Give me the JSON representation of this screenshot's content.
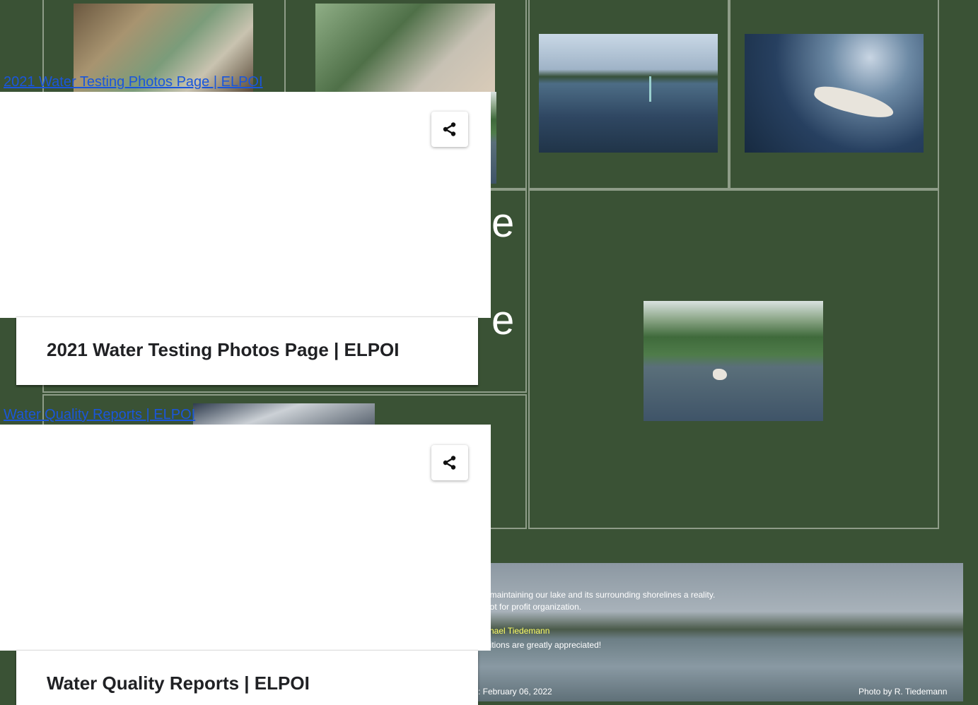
{
  "cards": [
    {
      "link_text": "2021 Water Testing Photos Page | ELPOI",
      "title": "2021 Water Testing Photos Page | ELPOI"
    },
    {
      "link_text": "Water Quality Reports | ELPOI",
      "title": "Water Quality Reports | ELPOI"
    }
  ],
  "background_page": {
    "partial_heading_char_1": "e",
    "partial_heading_char_2": "e",
    "banner": {
      "line1": "f maintaining our lake and its surrounding shorelines a reality.",
      "line2": "not for profit organization.",
      "line3": "chael Tiedemann",
      "line4": "ditions are greatly appreciated!",
      "date": ": February 06, 2022",
      "credit": "Photo by R. Tiedemann"
    }
  },
  "icons": {
    "share": "share-icon"
  },
  "colors": {
    "page_bg": "#3a5235",
    "link": "#1a56db",
    "cell_border": "#8e9c88",
    "banner_highlight": "#ffff66"
  }
}
